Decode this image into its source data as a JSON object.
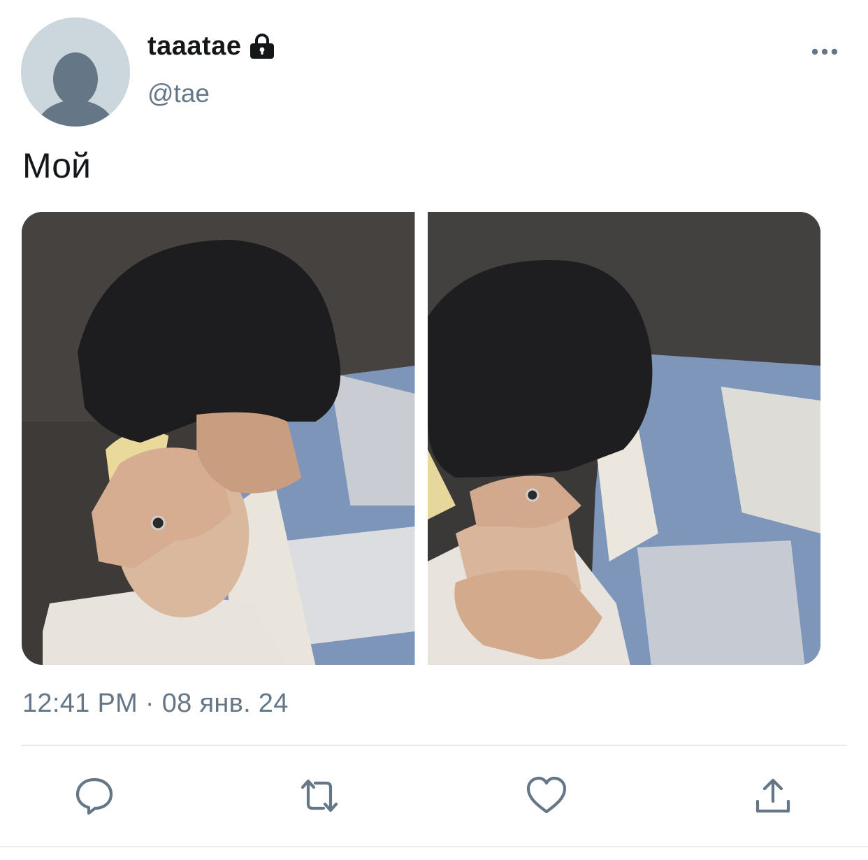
{
  "user": {
    "display_name": "taaatae",
    "handle": "@tae",
    "protected_icon": "lock-icon",
    "avatar_icon": "default-avatar-icon"
  },
  "tweet": {
    "text": "Мой",
    "timestamp": "12:41 PM · 08 янв. 24"
  },
  "media": {
    "count": 2
  },
  "actions": {
    "more_icon": "more-horizontal-icon",
    "reply_icon": "reply-icon",
    "retweet_icon": "retweet-icon",
    "like_icon": "heart-icon",
    "share_icon": "share-icon"
  },
  "colors": {
    "text_primary": "#14171a",
    "text_secondary": "#657786",
    "icon_gray": "#657786",
    "avatar_bg": "#ccd6dd",
    "avatar_fg": "#657786",
    "divider": "#e6ecf0"
  }
}
